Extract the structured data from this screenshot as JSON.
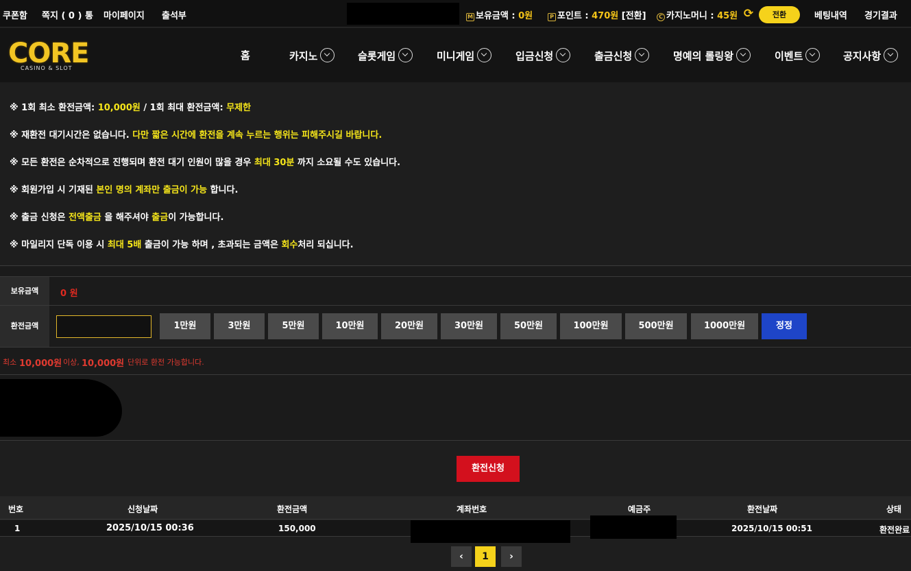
{
  "topbar": {
    "coupon": "쿠폰함",
    "message": "쪽지 ( 0 ) 통",
    "mypage": "마이페이지",
    "attendance": "출석부",
    "balance_label": "보유금액 :",
    "balance_value": "0원",
    "point_label": "포인트 :",
    "point_value": "470원",
    "point_convert": "[전환]",
    "casino_label": "카지노머니 :",
    "casino_value": "45원",
    "convert_button": "전환",
    "bet_history": "베팅내역",
    "game_results": "경기결과",
    "icons": {
      "balance": "M",
      "point": "P",
      "casino": "C"
    }
  },
  "nav": {
    "logo_text": "CORE",
    "logo_sub": "CASINO & SLOT",
    "items": [
      "홈",
      "카지노",
      "슬롯게임",
      "미니게임",
      "입금신청",
      "출금신청",
      "명예의 롤링왕",
      "이벤트",
      "공지사항"
    ]
  },
  "notices": [
    {
      "parts": [
        {
          "t": "※ 1회 최소 환전금액: "
        },
        {
          "t": "10,000원",
          "hl": true
        },
        {
          "t": " / 1회 최대 환전금액: "
        },
        {
          "t": "무제한",
          "hl": true
        }
      ]
    },
    {
      "parts": [
        {
          "t": "※ 재환전 대기시간은 없습니다. "
        },
        {
          "t": "다만 짧은 시간에 환전을 계속 누르는 행위는 피해주시길 바랍니다.",
          "hl": true
        }
      ]
    },
    {
      "parts": [
        {
          "t": "※ 모든 환전은 순차적으로 진행되며 환전 대기 인원이 많을 경우 "
        },
        {
          "t": "최대 30분",
          "hl": true
        },
        {
          "t": " 까지 소요될 수도 있습니다."
        }
      ]
    },
    {
      "parts": [
        {
          "t": "※ 회원가입 시 기재된 "
        },
        {
          "t": "본인 명의 계좌만 출금이 가능",
          "hl": true
        },
        {
          "t": " 합니다."
        }
      ]
    },
    {
      "parts": [
        {
          "t": "※ 출금 신청은 "
        },
        {
          "t": "전액출금",
          "hl": true
        },
        {
          "t": " 을 해주셔야 "
        },
        {
          "t": "출금",
          "hl": true
        },
        {
          "t": "이 가능합니다."
        }
      ]
    },
    {
      "parts": [
        {
          "t": "※ 마일리지 단독 이용 시 "
        },
        {
          "t": "최대 5배",
          "hl": true
        },
        {
          "t": " 출금이 가능 하며 , 초과되는 금액은 "
        },
        {
          "t": "회수",
          "hl": true
        },
        {
          "t": "처리 되십니다."
        }
      ]
    }
  ],
  "form": {
    "balance_label": "보유금액",
    "balance_value": "0 원",
    "amount_label": "환전금액",
    "amount_value": "",
    "amount_buttons": [
      "1만원",
      "3만원",
      "5만원",
      "10만원",
      "20만원",
      "30만원",
      "50만원",
      "100만원",
      "500만원",
      "1000만원"
    ],
    "reset_button": "정정",
    "hint_prefix": "최소",
    "hint_amount1": "10,000원",
    "hint_mid": "이상,",
    "hint_amount2": "10,000원",
    "hint_suffix": "단위로 환전 가능합니다.",
    "submit": "환전신청"
  },
  "table": {
    "headers": [
      "번호",
      "신청날짜",
      "환전금액",
      "계좌번호",
      "예금주",
      "환전날짜",
      "상태"
    ],
    "rows": [
      {
        "no": "1",
        "request_date": "2025/10/15 00:36",
        "amount": "150,000",
        "account": "",
        "holder": "",
        "done_date": "2025/10/15 00:51",
        "status": "환전완료"
      }
    ]
  },
  "pagination": {
    "prev": "‹",
    "current": "1",
    "next": "›"
  },
  "colors": {
    "accent_yellow": "#f5d21b",
    "highlight": "#f5e51a",
    "red": "#d3101d",
    "blue": "#1e45c8"
  }
}
